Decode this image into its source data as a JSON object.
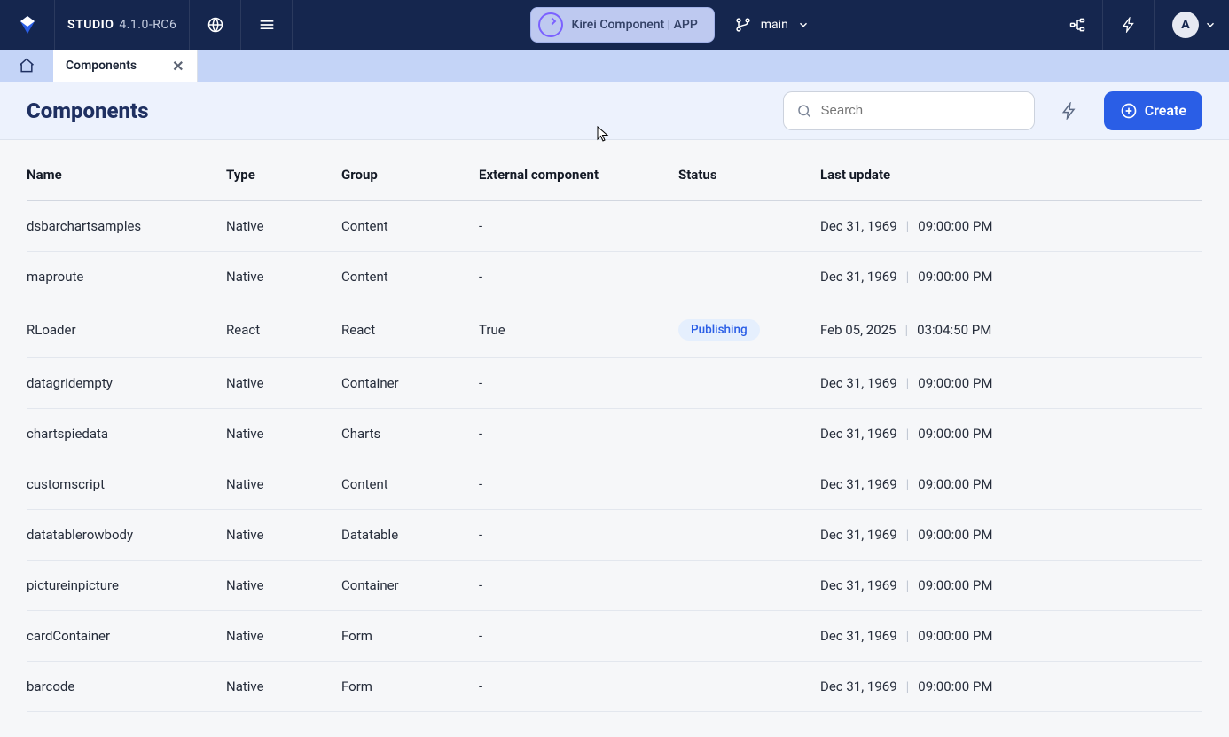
{
  "topbar": {
    "app_name": "STUDIO",
    "version": "4.1.0-RC6",
    "pill_label": "Kirei Component | APP",
    "branch_label": "main",
    "avatar_letter": "A"
  },
  "tab": {
    "label": "Components"
  },
  "page": {
    "title": "Components",
    "search_placeholder": "Search",
    "create_label": "Create"
  },
  "columns": {
    "name": "Name",
    "type": "Type",
    "group": "Group",
    "external": "External component",
    "status": "Status",
    "last_update": "Last update"
  },
  "rows": [
    {
      "name": "dsbarchartsamples",
      "type": "Native",
      "group": "Content",
      "external": "-",
      "status": "",
      "date": "Dec 31, 1969",
      "time": "09:00:00 PM"
    },
    {
      "name": "maproute",
      "type": "Native",
      "group": "Content",
      "external": "-",
      "status": "",
      "date": "Dec 31, 1969",
      "time": "09:00:00 PM"
    },
    {
      "name": "RLoader",
      "type": "React",
      "group": "React",
      "external": "True",
      "status": "Publishing",
      "date": "Feb 05, 2025",
      "time": "03:04:50 PM"
    },
    {
      "name": "datagridempty",
      "type": "Native",
      "group": "Container",
      "external": "-",
      "status": "",
      "date": "Dec 31, 1969",
      "time": "09:00:00 PM"
    },
    {
      "name": "chartspiedata",
      "type": "Native",
      "group": "Charts",
      "external": "-",
      "status": "",
      "date": "Dec 31, 1969",
      "time": "09:00:00 PM"
    },
    {
      "name": "customscript",
      "type": "Native",
      "group": "Content",
      "external": "-",
      "status": "",
      "date": "Dec 31, 1969",
      "time": "09:00:00 PM"
    },
    {
      "name": "datatablerowbody",
      "type": "Native",
      "group": "Datatable",
      "external": "-",
      "status": "",
      "date": "Dec 31, 1969",
      "time": "09:00:00 PM"
    },
    {
      "name": "pictureinpicture",
      "type": "Native",
      "group": "Container",
      "external": "-",
      "status": "",
      "date": "Dec 31, 1969",
      "time": "09:00:00 PM"
    },
    {
      "name": "cardContainer",
      "type": "Native",
      "group": "Form",
      "external": "-",
      "status": "",
      "date": "Dec 31, 1969",
      "time": "09:00:00 PM"
    },
    {
      "name": "barcode",
      "type": "Native",
      "group": "Form",
      "external": "-",
      "status": "",
      "date": "Dec 31, 1969",
      "time": "09:00:00 PM"
    }
  ]
}
